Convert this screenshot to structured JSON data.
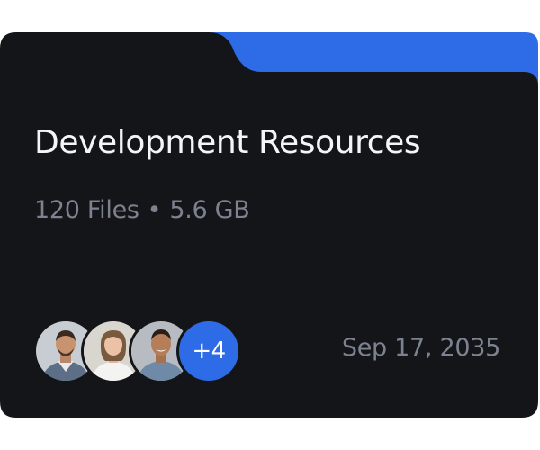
{
  "folder": {
    "title": "Development Resources",
    "file_count": "120 Files",
    "separator": "•",
    "size": "5.6 GB",
    "date": "Sep 17, 2035",
    "members": {
      "avatars": [
        {
          "name": "member-1"
        },
        {
          "name": "member-2"
        },
        {
          "name": "member-3"
        }
      ],
      "more_label": "+4"
    }
  },
  "colors": {
    "card_background": "#131518",
    "tab_accent": "#2e6be6",
    "title_text": "#f4f5f7",
    "muted_text": "#7c8290",
    "more_badge": "#2e6be6"
  },
  "icons": [
    "avatar-photo"
  ]
}
